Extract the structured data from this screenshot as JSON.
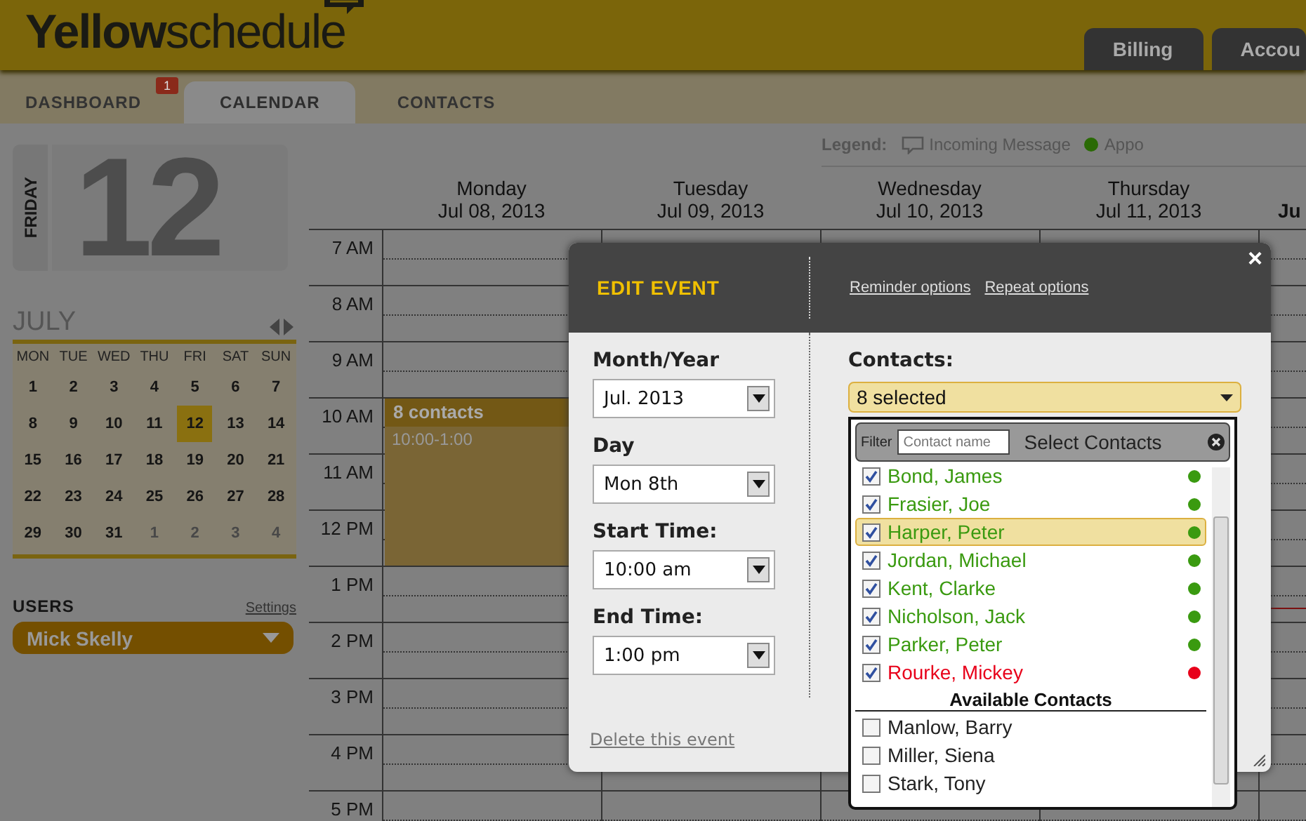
{
  "header": {
    "logo_bold": "Yellow",
    "logo_light": "schedule",
    "top_tabs": [
      {
        "label": "Billing"
      },
      {
        "label": "Accou"
      }
    ]
  },
  "nav_tabs": [
    {
      "label": "DASHBOARD",
      "selected": false,
      "badge": "1"
    },
    {
      "label": "CALENDAR",
      "selected": true
    },
    {
      "label": "CONTACTS",
      "selected": false
    }
  ],
  "sidebar": {
    "weekday": "FRIDAY",
    "day": "12",
    "month": "JULY",
    "weekdays": [
      "MON",
      "TUE",
      "WED",
      "THU",
      "FRI",
      "SAT",
      "SUN"
    ],
    "weeks": [
      [
        {
          "day": "1",
          "selected": false,
          "outside": false
        },
        {
          "day": "2",
          "selected": false,
          "outside": false
        },
        {
          "day": "3",
          "selected": false,
          "outside": false
        },
        {
          "day": "4",
          "selected": false,
          "outside": false
        },
        {
          "day": "5",
          "selected": false,
          "outside": false
        },
        {
          "day": "6",
          "selected": false,
          "outside": false
        },
        {
          "day": "7",
          "selected": false,
          "outside": false
        }
      ],
      [
        {
          "day": "8",
          "selected": false,
          "outside": false
        },
        {
          "day": "9",
          "selected": false,
          "outside": false
        },
        {
          "day": "10",
          "selected": false,
          "outside": false
        },
        {
          "day": "11",
          "selected": false,
          "outside": false
        },
        {
          "day": "12",
          "selected": true,
          "outside": false
        },
        {
          "day": "13",
          "selected": false,
          "outside": false
        },
        {
          "day": "14",
          "selected": false,
          "outside": false
        }
      ],
      [
        {
          "day": "15",
          "selected": false,
          "outside": false
        },
        {
          "day": "16",
          "selected": false,
          "outside": false
        },
        {
          "day": "17",
          "selected": false,
          "outside": false
        },
        {
          "day": "18",
          "selected": false,
          "outside": false
        },
        {
          "day": "19",
          "selected": false,
          "outside": false
        },
        {
          "day": "20",
          "selected": false,
          "outside": false
        },
        {
          "day": "21",
          "selected": false,
          "outside": false
        }
      ],
      [
        {
          "day": "22",
          "selected": false,
          "outside": false
        },
        {
          "day": "23",
          "selected": false,
          "outside": false
        },
        {
          "day": "24",
          "selected": false,
          "outside": false
        },
        {
          "day": "25",
          "selected": false,
          "outside": false
        },
        {
          "day": "26",
          "selected": false,
          "outside": false
        },
        {
          "day": "27",
          "selected": false,
          "outside": false
        },
        {
          "day": "28",
          "selected": false,
          "outside": false
        }
      ],
      [
        {
          "day": "29",
          "selected": false,
          "outside": false
        },
        {
          "day": "30",
          "selected": false,
          "outside": false
        },
        {
          "day": "31",
          "selected": false,
          "outside": false
        },
        {
          "day": "1",
          "selected": false,
          "outside": true
        },
        {
          "day": "2",
          "selected": false,
          "outside": true
        },
        {
          "day": "3",
          "selected": false,
          "outside": true
        },
        {
          "day": "4",
          "selected": false,
          "outside": true
        }
      ]
    ],
    "users_title": "USERS",
    "settings_link": "Settings",
    "user": "Mick Skelly"
  },
  "legend": {
    "label": "Legend:",
    "items": [
      {
        "kind": "message",
        "label": "Incoming Message"
      },
      {
        "kind": "dot",
        "label": "Appo"
      }
    ]
  },
  "calendar": {
    "days": [
      {
        "weekday": "Monday",
        "date": "Jul 08, 2013",
        "today": false,
        "events": [
          {
            "title": "8 contacts",
            "time": "10:00-1:00"
          }
        ]
      },
      {
        "weekday": "Tuesday",
        "date": "Jul 09, 2013",
        "today": false
      },
      {
        "weekday": "Wednesday",
        "date": "Jul 10, 2013",
        "today": false
      },
      {
        "weekday": "Thursday",
        "date": "Jul 11, 2013",
        "today": false
      },
      {
        "date": "Ju",
        "today": true
      }
    ],
    "hours": [
      "7 AM",
      "8 AM",
      "9 AM",
      "10 AM",
      "11 AM",
      "12 PM",
      "1 PM",
      "2 PM",
      "3 PM",
      "4 PM",
      "5 PM"
    ]
  },
  "modal": {
    "title": "EDIT EVENT",
    "close": "×",
    "links": [
      "Reminder options",
      "Repeat options"
    ],
    "fields": [
      {
        "label": "Month/Year",
        "value": "Jul. 2013"
      },
      {
        "label": "Day",
        "value": "Mon 8th"
      },
      {
        "label": "Start Time:",
        "value": "10:00 am"
      },
      {
        "label": "End Time:",
        "value": "1:00 pm"
      }
    ],
    "delete_link": "Delete this event",
    "contacts_label": "Contacts:",
    "contacts_summary": "8 selected"
  },
  "contact_list": {
    "filter_label": "Filter",
    "filter_placeholder": "Contact name",
    "title": "Select Contacts",
    "selected_contacts": [
      {
        "name": "Bond, James",
        "checked": true,
        "selected": false,
        "color": "#3a9a10"
      },
      {
        "name": "Frasier, Joe",
        "checked": true,
        "selected": false,
        "color": "#3a9a10"
      },
      {
        "name": "Harper, Peter",
        "checked": true,
        "selected": true,
        "color": "#3a9a10"
      },
      {
        "name": "Jordan, Michael",
        "checked": true,
        "selected": false,
        "color": "#3a9a10"
      },
      {
        "name": "Kent, Clarke",
        "checked": true,
        "selected": false,
        "color": "#3a9a10"
      },
      {
        "name": "Nicholson, Jack",
        "checked": true,
        "selected": false,
        "color": "#3a9a10"
      },
      {
        "name": "Parker, Peter",
        "checked": true,
        "selected": false,
        "color": "#3a9a10"
      },
      {
        "name": "Rourke, Mickey",
        "checked": true,
        "selected": false,
        "color": "#e8001a"
      }
    ],
    "available_title": "Available Contacts",
    "available_contacts": [
      {
        "name": "Manlow, Barry",
        "checked": false
      },
      {
        "name": "Miller, Siena",
        "checked": false
      },
      {
        "name": "Stark, Tony",
        "checked": false
      }
    ]
  }
}
